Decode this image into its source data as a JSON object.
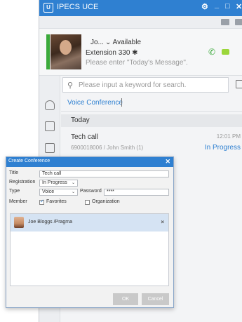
{
  "app": {
    "title": "IPECS UCE",
    "logo": "U",
    "window_controls": {
      "settings": "⚙",
      "minimize": "_",
      "maximize": "□",
      "close": "✕"
    }
  },
  "profile": {
    "name": "Jo...",
    "status": "Available",
    "extension": "Extension 330",
    "message_placeholder": "Please enter \"Today's Message\"."
  },
  "search": {
    "placeholder": "Please input a keyword for search."
  },
  "conference": {
    "tab_label": "Voice Conference",
    "group_header": "Today",
    "item": {
      "title": "Tech call",
      "time": "12:01 PM",
      "subtitle": "6900018006 / John Smith (1)",
      "status": "In Progress"
    }
  },
  "dialog": {
    "title": "Create Conference",
    "close": "✕",
    "title_label": "Title",
    "title_value": "Tech call",
    "registration_label": "Registration",
    "registration_value": "In Progress",
    "type_label": "Type",
    "type_value": "Voice",
    "password_label": "Password",
    "password_value": "****",
    "member_label": "Member",
    "favorites_label": "Favorites",
    "favorites_checked": true,
    "organization_label": "Organization",
    "organization_checked": false,
    "members": [
      {
        "name": "Joe Bloggs /Pragma"
      }
    ],
    "ok_label": "OK",
    "cancel_label": "Cancel"
  },
  "colors": {
    "accent": "#2f80d1",
    "presence_green": "#3aa93a",
    "member_highlight": "#d5e3f3"
  }
}
